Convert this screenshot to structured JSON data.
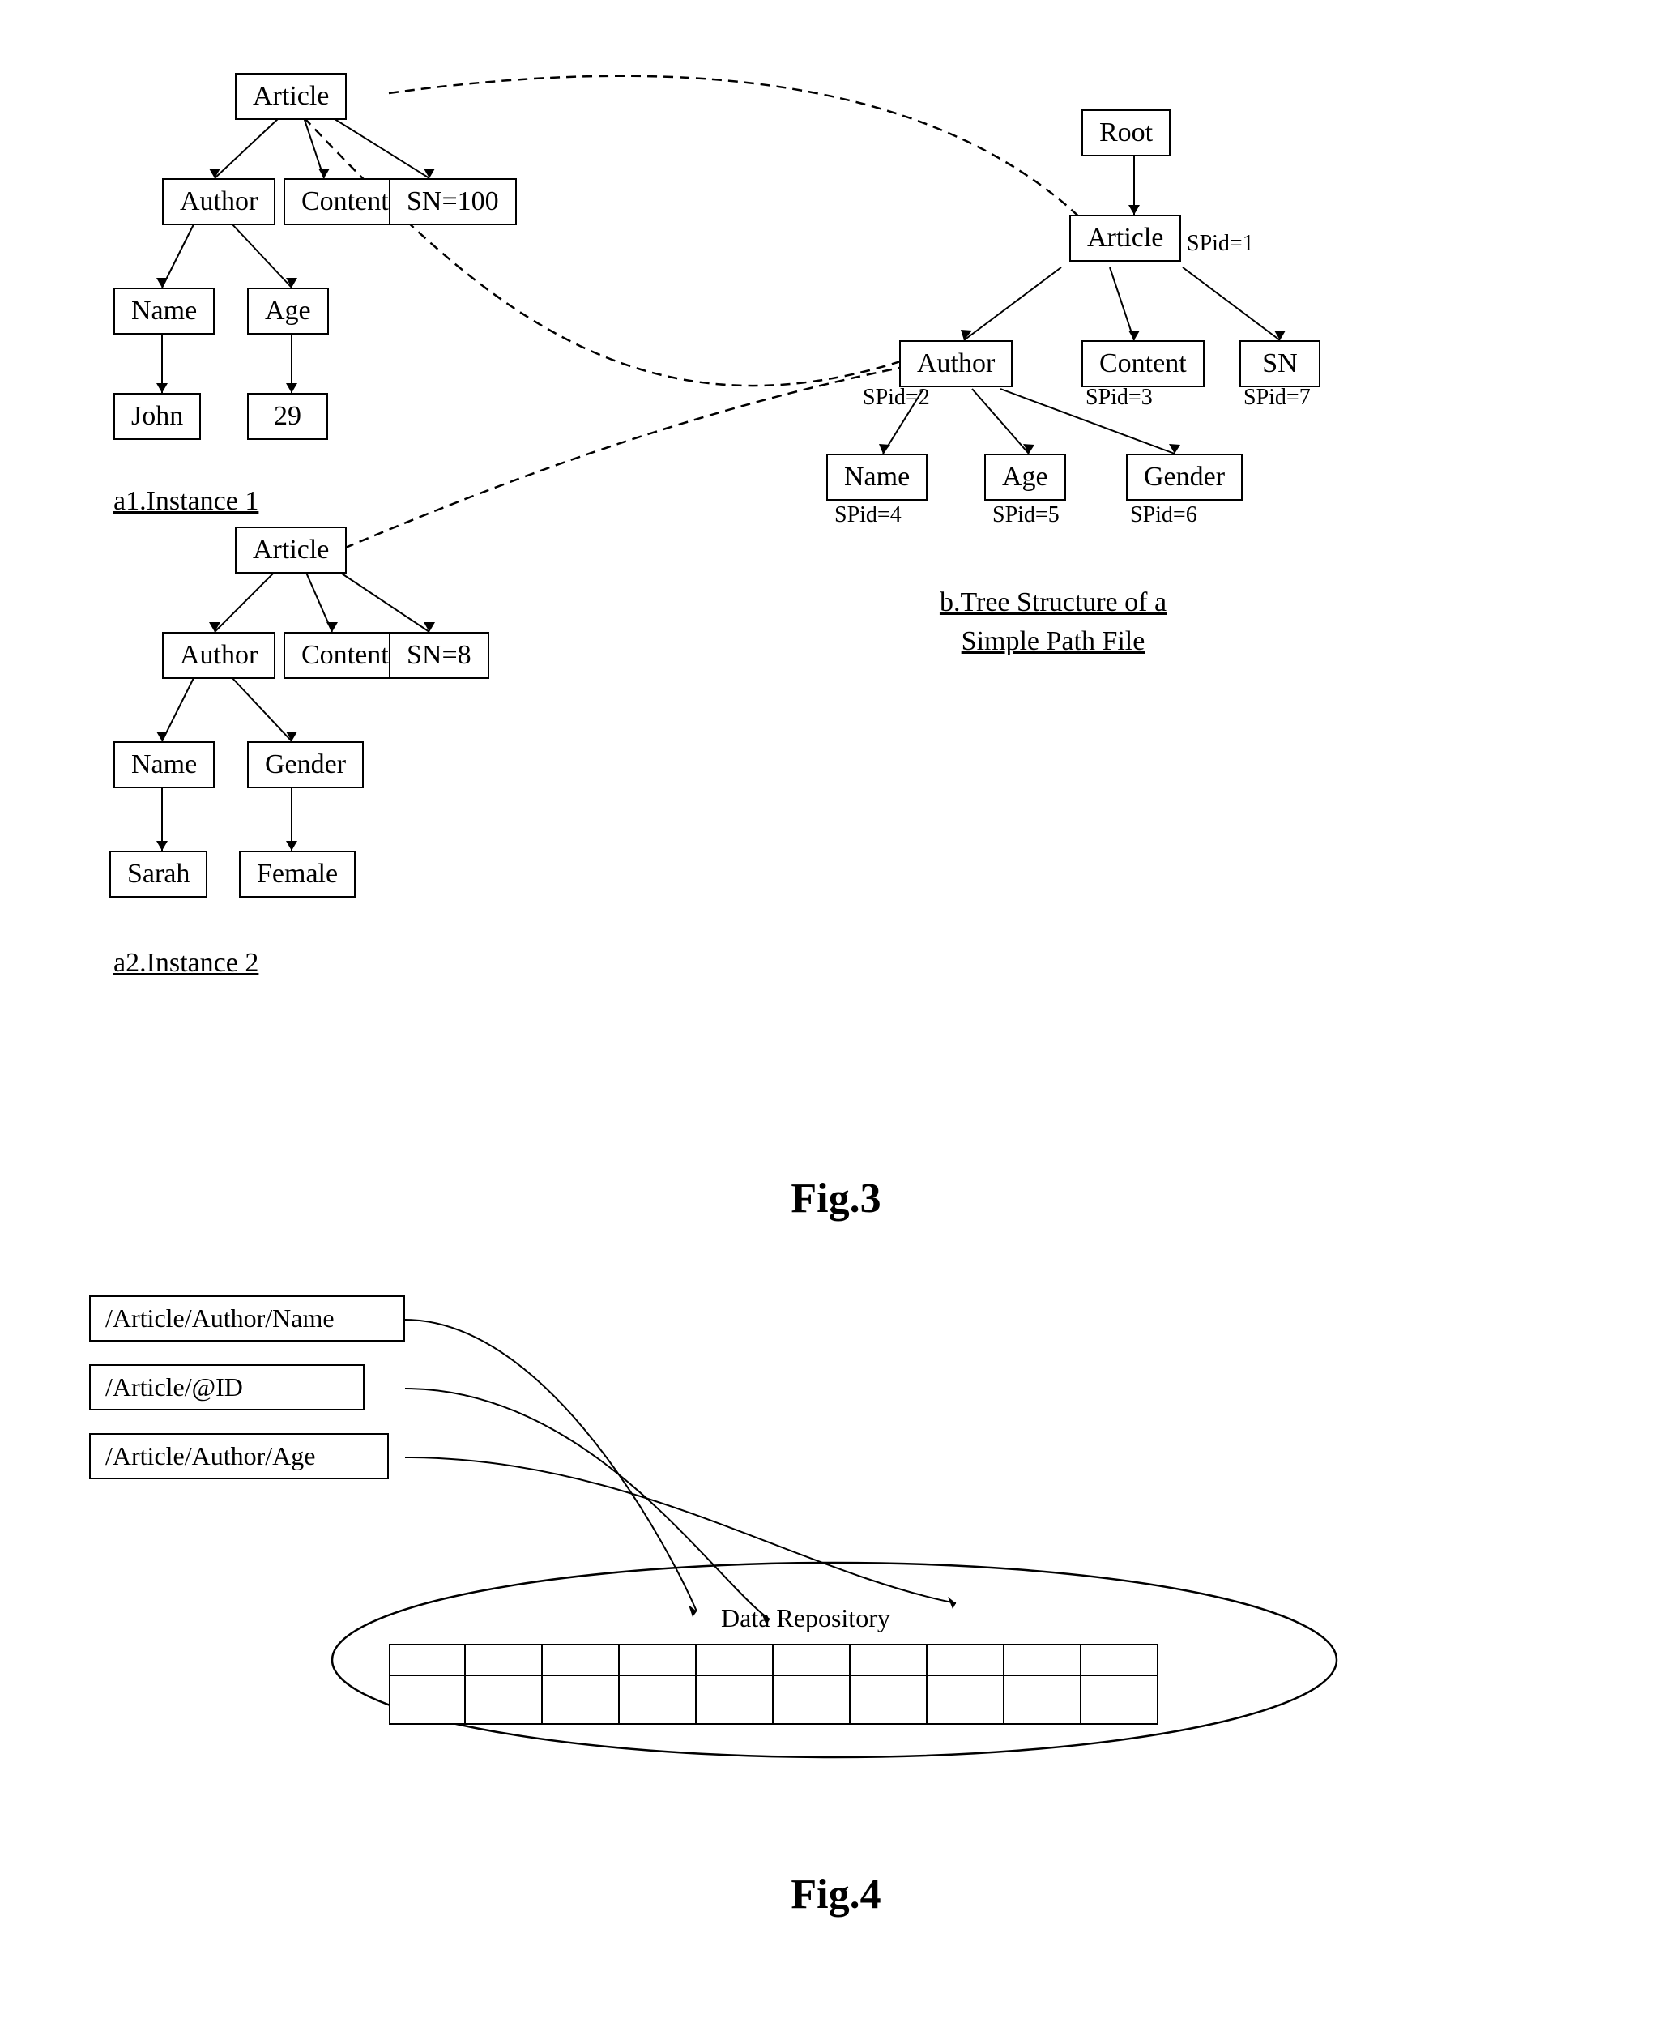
{
  "fig3": {
    "label": "Fig.3",
    "subtitle_b": "b.Tree Structure of a Simple Path File",
    "subtitle_a1": "a1.Instance   1",
    "subtitle_a2": "a2.Instance   2",
    "nodes": {
      "left_tree1": {
        "article1": "Article",
        "author1": "Author",
        "content1": "Content",
        "sn100": "SN=100",
        "name1": "Name",
        "age1": "Age",
        "john": "John",
        "n29": "29"
      },
      "left_tree2": {
        "article2": "Article",
        "author2": "Author",
        "content2": "Content",
        "sn8": "SN=8",
        "name2": "Name",
        "gender2": "Gender",
        "sarah": "Sarah",
        "female": "Female"
      },
      "right_tree": {
        "root": "Root",
        "article": "Article",
        "spid1": "SPid=1",
        "author": "Author",
        "content": "Content",
        "sn": "SN",
        "spid2": "SPid=2",
        "spid3": "SPid=3",
        "spid7": "SPid=7",
        "name": "Name",
        "age": "Age",
        "gender": "Gender",
        "spid4": "SPid=4",
        "spid5": "SPid=5",
        "spid6": "SPid=6"
      }
    }
  },
  "fig4": {
    "label": "Fig.4",
    "paths": [
      "/Article/Author/Name",
      "/Article/@ID",
      "/Article/Author/Age"
    ],
    "repo_label": "Data Repository"
  }
}
